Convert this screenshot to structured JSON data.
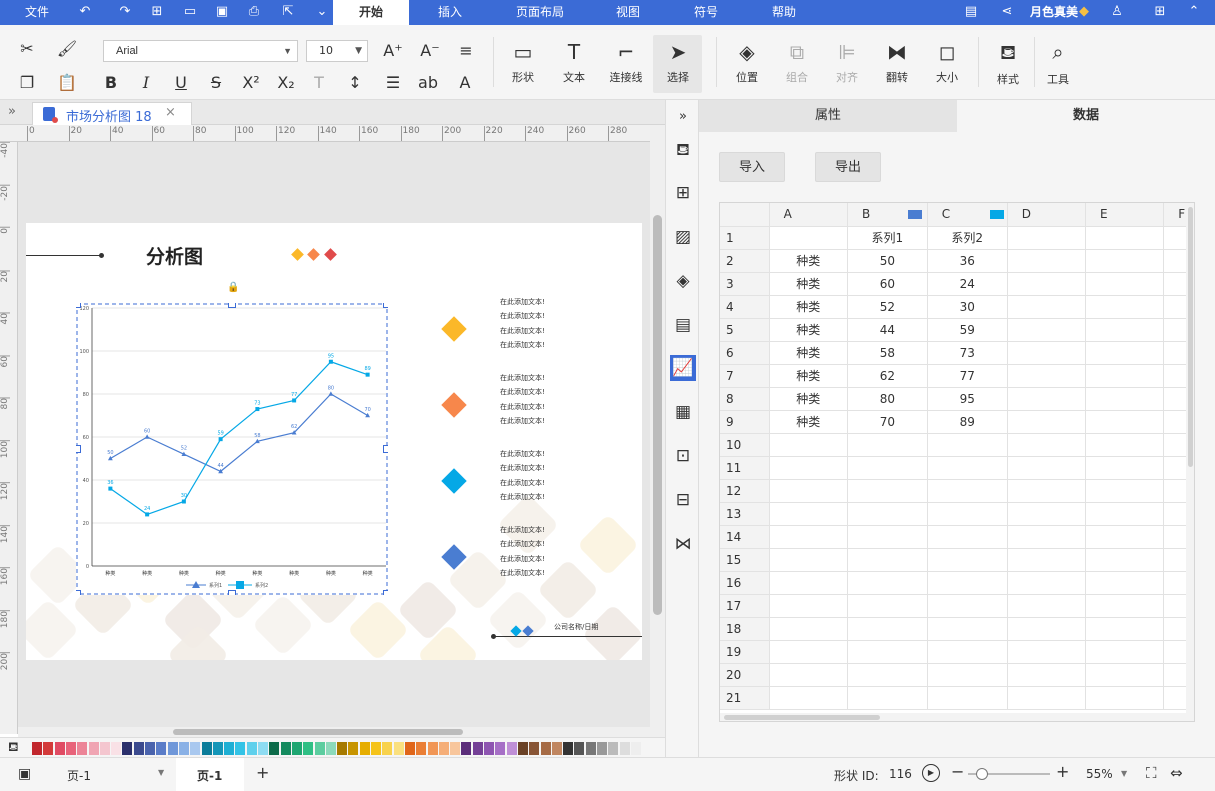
{
  "menubar": {
    "file": "文件",
    "tabs": [
      "开始",
      "插入",
      "页面布局",
      "视图",
      "符号",
      "帮助"
    ],
    "active_tab": "开始",
    "user": "月色真美"
  },
  "toolbar": {
    "font_name": "Arial",
    "font_size": "10",
    "shape_label": "形状",
    "text_label": "文本",
    "connector_label": "连接线",
    "select_label": "选择",
    "position_label": "位置",
    "group_label": "组合",
    "align_label": "对齐",
    "flip_label": "翻转",
    "size_label": "大小",
    "style_label": "样式",
    "tools_label": "工具"
  },
  "document": {
    "tab_title": "市场分析图 18"
  },
  "ruler": {
    "h_ticks": [
      "0",
      "20",
      "40",
      "60",
      "80",
      "100",
      "120",
      "140",
      "160",
      "180",
      "200",
      "220",
      "240",
      "260",
      "280"
    ],
    "v_ticks": [
      "-40",
      "-20",
      "0",
      "20",
      "40",
      "60",
      "80",
      "100",
      "120",
      "140",
      "160",
      "180",
      "200"
    ]
  },
  "page": {
    "title": "分析图",
    "legend_texts": [
      "在此添加文本!",
      "在此添加文本!",
      "在此添加文本!",
      "在此添加文本!"
    ],
    "company_date": "公司名称/日期",
    "colors": {
      "yellow": "#fbb829",
      "orange": "#f7874b",
      "blue": "#05a8e6",
      "dblue": "#4a7dd1",
      "red": "#e04b4b"
    }
  },
  "chart_data": {
    "type": "line",
    "categories": [
      "种类",
      "种类",
      "种类",
      "种类",
      "种类",
      "种类",
      "种类",
      "种类"
    ],
    "series": [
      {
        "name": "系列1",
        "values": [
          50,
          60,
          52,
          44,
          58,
          62,
          80,
          70
        ],
        "color": "#4a7dd1"
      },
      {
        "name": "系列2",
        "values": [
          36,
          24,
          30,
          59,
          73,
          77,
          95,
          89
        ],
        "color": "#05a8e6"
      }
    ],
    "ylim": [
      0,
      120
    ],
    "yticks": [
      "0",
      "20",
      "40",
      "60",
      "80",
      "100",
      "120"
    ],
    "grid": true,
    "legend": "bottom"
  },
  "panel": {
    "tab_properties": "属性",
    "tab_data": "数据",
    "import": "导入",
    "export": "导出",
    "columns": [
      "A",
      "B",
      "C",
      "D",
      "E",
      "F"
    ],
    "row_numbers": [
      "1",
      "2",
      "3",
      "4",
      "5",
      "6",
      "7",
      "8",
      "9",
      "10",
      "11",
      "12",
      "13",
      "14",
      "15",
      "16",
      "17",
      "18",
      "19",
      "20",
      "21"
    ],
    "header_row": [
      "",
      "系列1",
      "系列2"
    ],
    "rows": [
      [
        "种类",
        "50",
        "36"
      ],
      [
        "种类",
        "60",
        "24"
      ],
      [
        "种类",
        "52",
        "30"
      ],
      [
        "种类",
        "44",
        "59"
      ],
      [
        "种类",
        "58",
        "73"
      ],
      [
        "种类",
        "62",
        "77"
      ],
      [
        "种类",
        "80",
        "95"
      ],
      [
        "种类",
        "70",
        "89"
      ]
    ]
  },
  "status": {
    "page_select": "页-1",
    "page_tab": "页-1",
    "shape_id_label": "形状 ID:",
    "shape_id": "116",
    "zoom": "55%"
  }
}
